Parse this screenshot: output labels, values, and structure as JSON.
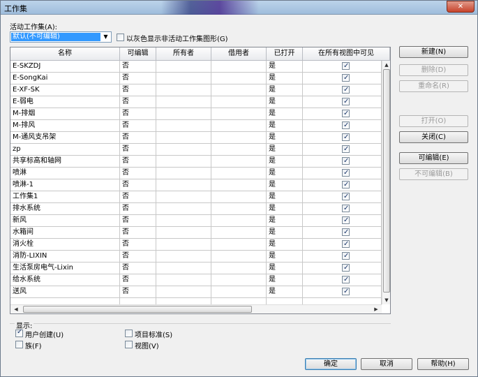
{
  "window": {
    "title": "工作集"
  },
  "active": {
    "label": "活动工作集(A):",
    "value": "默认(不可编辑)",
    "gray_label": "以灰色显示非活动工作集图形(G)"
  },
  "columns": [
    "名称",
    "可编辑",
    "所有者",
    "借用者",
    "已打开",
    "在所有视图中可见"
  ],
  "rows": [
    {
      "name": "E-SKZDJ",
      "editable": "否",
      "owner": "",
      "borrower": "",
      "opened": "是",
      "visible": true
    },
    {
      "name": "E-SongKai",
      "editable": "否",
      "owner": "",
      "borrower": "",
      "opened": "是",
      "visible": true
    },
    {
      "name": "E-XF-SK",
      "editable": "否",
      "owner": "",
      "borrower": "",
      "opened": "是",
      "visible": true
    },
    {
      "name": "E-弱电",
      "editable": "否",
      "owner": "",
      "borrower": "",
      "opened": "是",
      "visible": true
    },
    {
      "name": "M-排烟",
      "editable": "否",
      "owner": "",
      "borrower": "",
      "opened": "是",
      "visible": true
    },
    {
      "name": "M-排风",
      "editable": "否",
      "owner": "",
      "borrower": "",
      "opened": "是",
      "visible": true
    },
    {
      "name": "M-通风支吊架",
      "editable": "否",
      "owner": "",
      "borrower": "",
      "opened": "是",
      "visible": true
    },
    {
      "name": "zp",
      "editable": "否",
      "owner": "",
      "borrower": "",
      "opened": "是",
      "visible": true
    },
    {
      "name": "共享标高和轴网",
      "editable": "否",
      "owner": "",
      "borrower": "",
      "opened": "是",
      "visible": true
    },
    {
      "name": "喷淋",
      "editable": "否",
      "owner": "",
      "borrower": "",
      "opened": "是",
      "visible": true
    },
    {
      "name": "喷淋-1",
      "editable": "否",
      "owner": "",
      "borrower": "",
      "opened": "是",
      "visible": true
    },
    {
      "name": "工作集1",
      "editable": "否",
      "owner": "",
      "borrower": "",
      "opened": "是",
      "visible": true
    },
    {
      "name": "排水系统",
      "editable": "否",
      "owner": "",
      "borrower": "",
      "opened": "是",
      "visible": true
    },
    {
      "name": "新风",
      "editable": "否",
      "owner": "",
      "borrower": "",
      "opened": "是",
      "visible": true
    },
    {
      "name": "水箱间",
      "editable": "否",
      "owner": "",
      "borrower": "",
      "opened": "是",
      "visible": true
    },
    {
      "name": "消火栓",
      "editable": "否",
      "owner": "",
      "borrower": "",
      "opened": "是",
      "visible": true
    },
    {
      "name": "消防-LIXIN",
      "editable": "否",
      "owner": "",
      "borrower": "",
      "opened": "是",
      "visible": true
    },
    {
      "name": "生活泵房电气-Lixin",
      "editable": "否",
      "owner": "",
      "borrower": "",
      "opened": "是",
      "visible": true
    },
    {
      "name": "给水系统",
      "editable": "否",
      "owner": "",
      "borrower": "",
      "opened": "是",
      "visible": true
    },
    {
      "name": "送风",
      "editable": "否",
      "owner": "",
      "borrower": "",
      "opened": "是",
      "visible": true
    }
  ],
  "side_buttons": {
    "new": "新建(N)",
    "delete": "删除(D)",
    "rename": "重命名(R)",
    "open": "打开(O)",
    "close": "关闭(C)",
    "editable": "可编辑(E)",
    "not_editable": "不可编辑(B)"
  },
  "display": {
    "label": "显示:",
    "user_created": "用户创建(U)",
    "project_standards": "项目标准(S)",
    "families": "族(F)",
    "views": "视图(V)"
  },
  "footer": {
    "ok": "确定",
    "cancel": "取消",
    "help": "帮助(H)"
  }
}
